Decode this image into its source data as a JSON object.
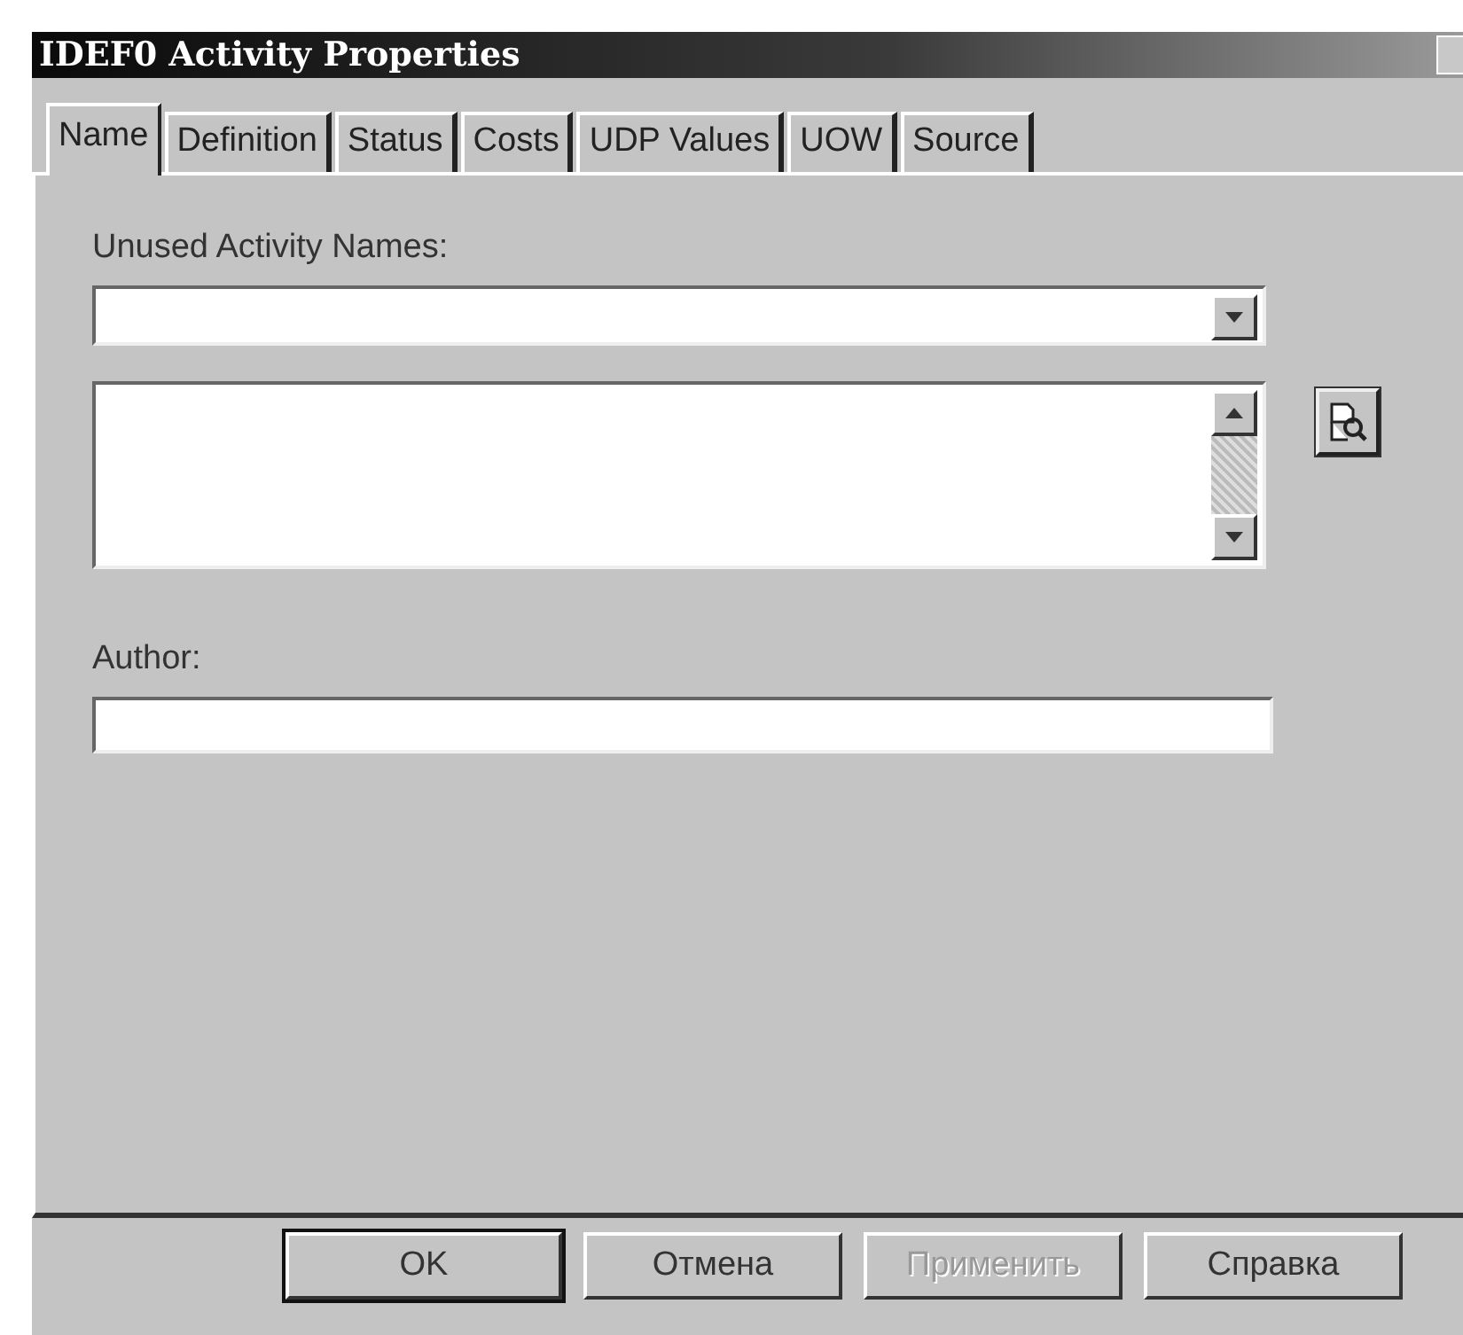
{
  "window": {
    "title": "IDEF0 Activity Properties"
  },
  "tabs": [
    {
      "label": "Name",
      "selected": true
    },
    {
      "label": "Definition",
      "selected": false
    },
    {
      "label": "Status",
      "selected": false
    },
    {
      "label": "Costs",
      "selected": false
    },
    {
      "label": "UDP Values",
      "selected": false
    },
    {
      "label": "UOW",
      "selected": false
    },
    {
      "label": "Source",
      "selected": false
    }
  ],
  "name_tab": {
    "unused_names_label": "Unused Activity Names:",
    "author_label": "Author:"
  },
  "buttons": [
    {
      "label": "OK",
      "default": true,
      "disabled": false
    },
    {
      "label": "Отмена",
      "default": false,
      "disabled": false
    },
    {
      "label": "Применить",
      "default": false,
      "disabled": true
    },
    {
      "label": "Справка",
      "default": false,
      "disabled": false
    }
  ]
}
